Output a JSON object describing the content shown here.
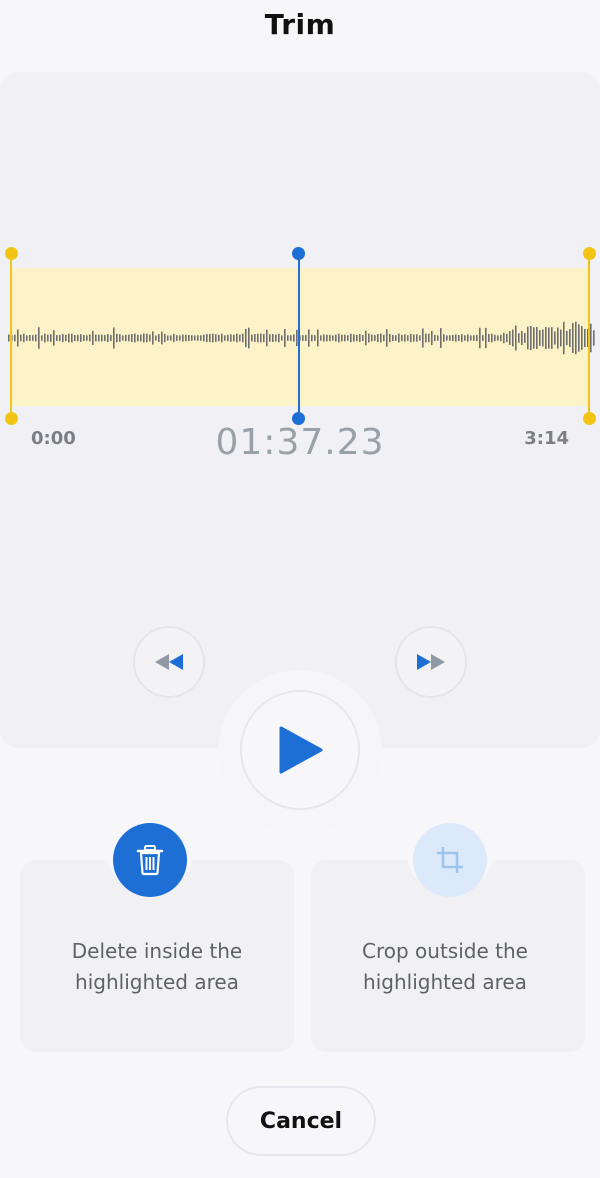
{
  "header": {
    "title": "Trim"
  },
  "timeline": {
    "start_time": "0:00",
    "end_time": "3:14",
    "current_time": "01:37.23",
    "playhead_fraction": 0.5
  },
  "controls": {
    "rewind_icon": "rewind-icon",
    "forward_icon": "fast-forward-icon",
    "play_icon": "play-icon"
  },
  "actions": {
    "delete": {
      "icon": "trash-icon",
      "label_line1": "Delete inside the",
      "label_line2": "highlighted area",
      "enabled": true
    },
    "crop": {
      "icon": "crop-icon",
      "label_line1": "Crop outside the",
      "label_line2": "highlighted area",
      "enabled": false
    }
  },
  "footer": {
    "cancel_label": "Cancel"
  },
  "colors": {
    "accent": "#1d6fd6",
    "selection": "#fbf2c7",
    "handle": "#f2c515",
    "crop_disabled": "#dbe9fb"
  }
}
